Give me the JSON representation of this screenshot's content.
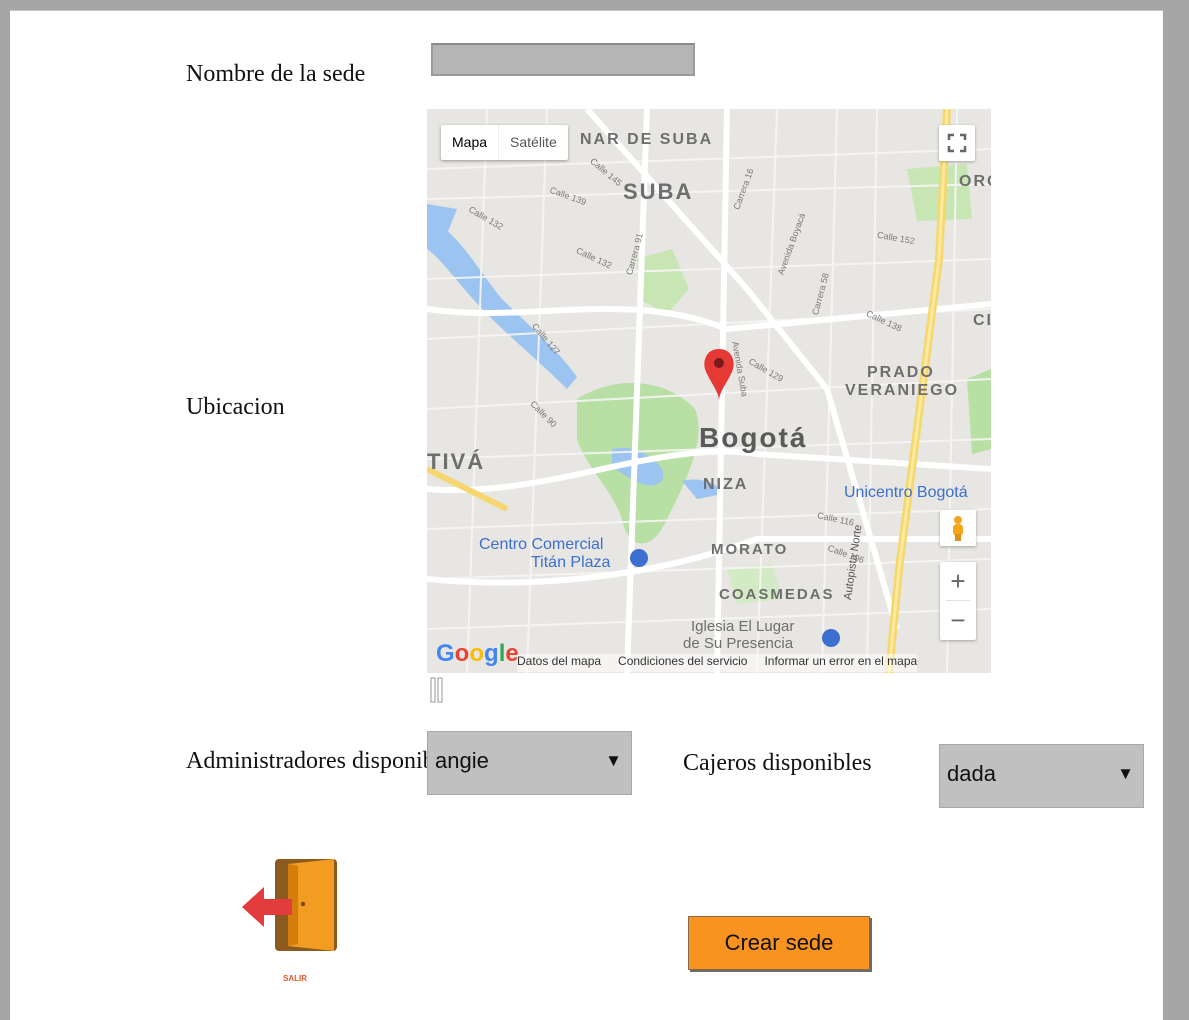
{
  "form": {
    "name_label": "Nombre de la sede",
    "name_value": "",
    "location_label": "Ubicacion",
    "admins_label": "Administradores disponibles",
    "admins_selected": "angie",
    "cashiers_label": "Cajeros disponibles",
    "cashiers_selected": "dada",
    "create_button": "Crear sede",
    "exit_label": "SALIR"
  },
  "map": {
    "type_map": "Mapa",
    "type_satellite": "Satélite",
    "labels": {
      "suba_top": "NAR DE SUBA",
      "suba": "SUBA",
      "orq": "ORO",
      "ci": "CI",
      "prado_1": "PRADO",
      "prado_2": "VERANIEGO",
      "bogota": "Bogotá",
      "tiva": "TIVÁ",
      "niza": "NIZA",
      "unicentro": "Unicentro Bogotá",
      "titan_1": "Centro Comercial",
      "titan_2": "Titán Plaza",
      "morato": "MORATO",
      "coasmedas": "COASMEDAS",
      "iglesia_1": "Iglesia El Lugar",
      "iglesia_2": "de Su Presencia",
      "autopista": "Autopista Norte",
      "calle_145": "Calle 145",
      "calle_139": "Calle 139",
      "calle_132a": "Calle 132",
      "calle_132b": "Calle 132",
      "calle_127": "Calle 127",
      "calle_90": "Calle 90",
      "calle_129": "Calle 129",
      "calle_138": "Calle 138",
      "calle_152": "Calle 152",
      "calle_116": "Calle 116",
      "calle_106": "Calle 106",
      "avenida_suba": "Avenida Suba",
      "avenida_boyaca": "Avenida Boyacá",
      "carrera_91": "Carrera 91",
      "carrera_58": "Carrera 58",
      "carrera_16": "Carrera 16"
    },
    "attribution": [
      "Datos del mapa",
      "Condiciones del servicio",
      "Informar un error en el mapa"
    ],
    "logo": "Google",
    "zoom_in": "+",
    "zoom_out": "−",
    "colors": {
      "land": "#e8e6e2",
      "park": "#b8dfa4",
      "water": "#9cc4f0",
      "road": "#ffffff",
      "highway": "#f5d76e",
      "marker": "#e53935",
      "poi": "#3c6fd0"
    }
  },
  "colors": {
    "create_button": "#f7931e",
    "select_bg": "#c0c0c0",
    "page_bg": "#ffffff",
    "frame_bg": "#a6a6a6"
  }
}
